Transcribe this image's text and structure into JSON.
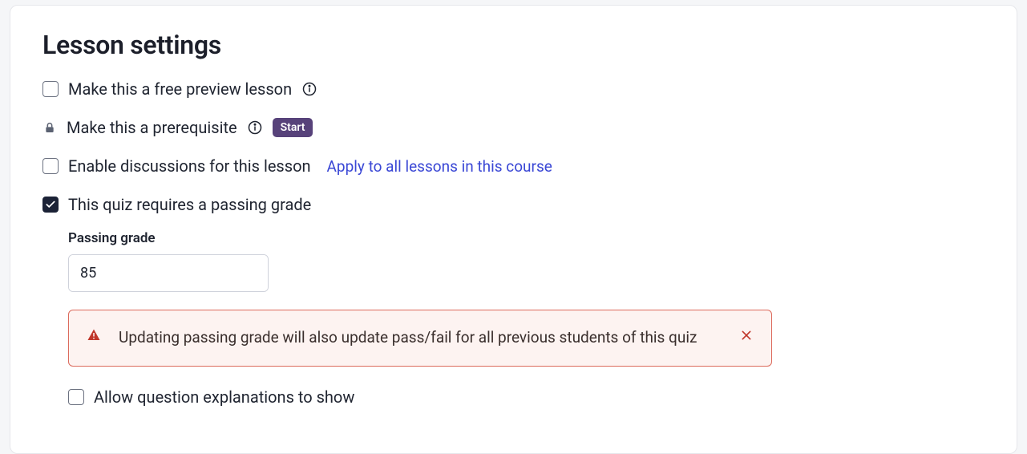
{
  "title": "Lesson settings",
  "options": {
    "free_preview": {
      "label": "Make this a free preview lesson",
      "checked": false
    },
    "prerequisite": {
      "label": "Make this a prerequisite",
      "badge": "Start"
    },
    "discussions": {
      "label": "Enable discussions for this lesson",
      "checked": false,
      "apply_link": "Apply to all lessons in this course"
    },
    "passing_grade_required": {
      "label": "This quiz requires a passing grade",
      "checked": true
    },
    "allow_explanations": {
      "label": "Allow question explanations to show",
      "checked": false
    }
  },
  "passing_grade": {
    "label": "Passing grade",
    "value": "85",
    "suffix": "%"
  },
  "alert": {
    "message": "Updating passing grade will also update pass/fail for all previous students of this quiz"
  }
}
